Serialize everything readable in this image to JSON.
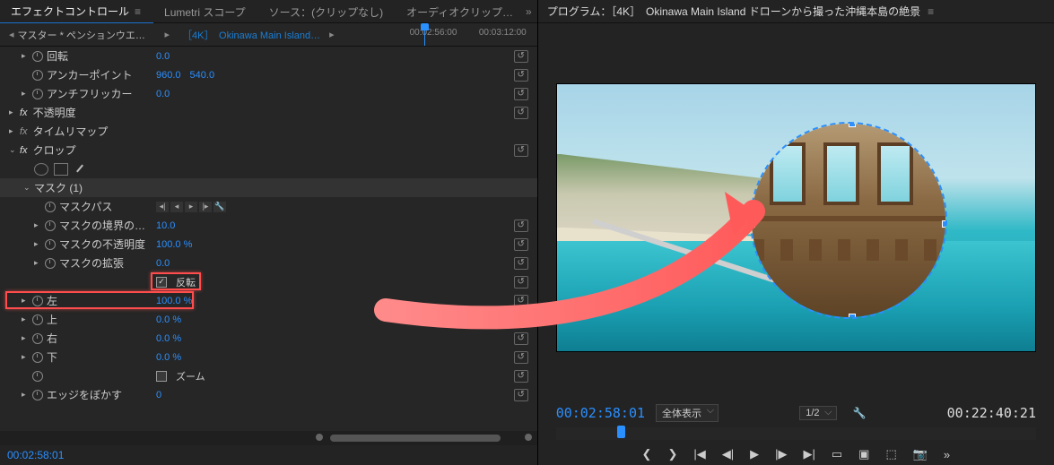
{
  "tabs": {
    "effect_controls": "エフェクトコントロール",
    "lumetri": "Lumetri スコープ",
    "source": "ソース：(クリップなし)",
    "audio": "オーディオクリップ…"
  },
  "subheader": {
    "master": "マスター * ペンションウエ…",
    "clip": "［4K］　Okinawa Main Island…",
    "tc1": "00:02:56:00",
    "tc2": "00:03:12:00"
  },
  "effects": {
    "rotation": {
      "label": "回転",
      "value": "0.0"
    },
    "anchor": {
      "label": "アンカーポイント",
      "vx": "960.0",
      "vy": "540.0"
    },
    "antiflicker": {
      "label": "アンチフリッカー",
      "value": "0.0"
    },
    "opacity": {
      "label": "不透明度"
    },
    "timeremap": {
      "label": "タイムリマップ"
    },
    "crop": {
      "label": "クロップ"
    },
    "mask": {
      "label": "マスク (1)"
    },
    "maskpath": {
      "label": "マスクパス"
    },
    "maskfeather": {
      "label": "マスクの境界の…",
      "value": "10.0"
    },
    "maskopacity": {
      "label": "マスクの不透明度",
      "value": "100.0 %"
    },
    "maskexpand": {
      "label": "マスクの拡張",
      "value": "0.0"
    },
    "invert": {
      "label": "反転"
    },
    "left": {
      "label": "左",
      "value": "100.0 %"
    },
    "top": {
      "label": "上",
      "value": "0.0 %"
    },
    "right_": {
      "label": "右",
      "value": "0.0 %"
    },
    "bottom": {
      "label": "下",
      "value": "0.0 %"
    },
    "zoom": {
      "label": "ズーム"
    },
    "edgefeather": {
      "label": "エッジをぼかす",
      "value": "0"
    }
  },
  "footer_tc": "00:02:58:01",
  "program": {
    "title": "プログラム：［4K］　Okinawa Main Island ドローンから撮った沖縄本島の絶景",
    "current_tc": "00:02:58:01",
    "total_tc": "00:22:40:21",
    "fit": "全体表示",
    "res": "1/2"
  },
  "icons": {
    "reset": "↺",
    "check": "✓",
    "mark_in": "❮",
    "mark_out": "❯",
    "goto_in": "|◀",
    "step_back": "◀|",
    "play": "▶",
    "step_fwd": "|▶",
    "goto_out": "▶|",
    "lift": "▭",
    "extract": "▣",
    "export": "⬚",
    "camera": "📷",
    "more": "»",
    "wrench": "🔧",
    "menu": "≡",
    "chev": "▸",
    "chev_d": "⌄"
  }
}
